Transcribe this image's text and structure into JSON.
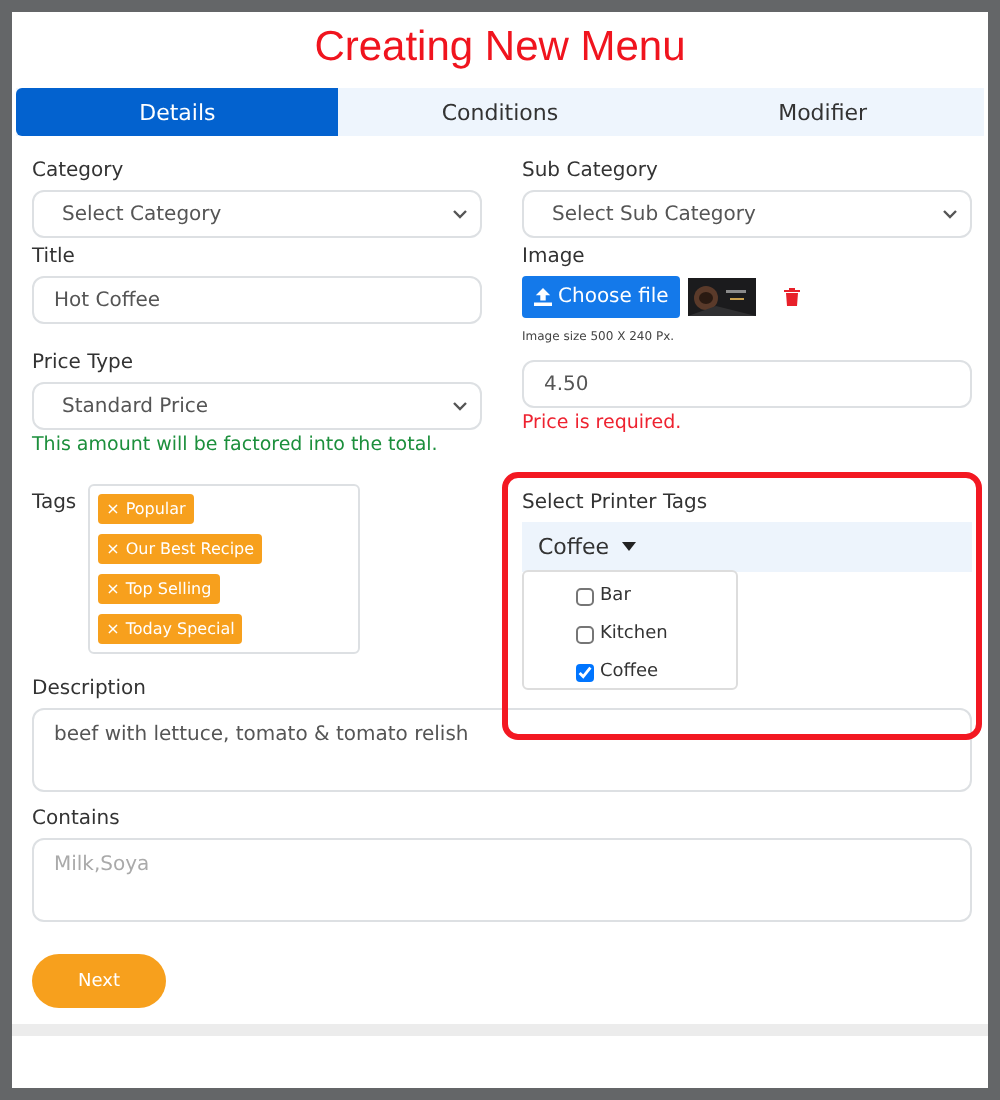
{
  "title": "Creating New Menu",
  "tabs": [
    {
      "label": "Details",
      "selected": true
    },
    {
      "label": "Conditions",
      "selected": false
    },
    {
      "label": "Modifier",
      "selected": false
    }
  ],
  "category": {
    "label": "Category",
    "value": "Select Category"
  },
  "sub_category": {
    "label": "Sub Category",
    "value": "Select Sub Category"
  },
  "title_field": {
    "label": "Title",
    "value": "Hot Coffee"
  },
  "image": {
    "label": "Image",
    "button": "Choose file",
    "hint": "Image size 500 X 240 Px."
  },
  "price_type": {
    "label": "Price Type",
    "value": "Standard Price",
    "note": "This amount will be factored into the total."
  },
  "price": {
    "value": "4.50",
    "error": "Price is required."
  },
  "tags": {
    "label": "Tags",
    "items": [
      "Popular",
      "Our Best Recipe",
      "Top Selling",
      "Today Special"
    ],
    "remove_glyph": "×"
  },
  "printer_tags": {
    "label": "Select Printer Tags",
    "button": "Coffee",
    "expanded": true,
    "options": [
      {
        "label": "Bar",
        "checked": false
      },
      {
        "label": "Kitchen",
        "checked": false
      },
      {
        "label": "Coffee",
        "checked": true
      }
    ]
  },
  "description": {
    "label": "Description",
    "value": "beef with lettuce, tomato & tomato relish"
  },
  "contains": {
    "label": "Contains",
    "placeholder": "Milk,Soya"
  },
  "next_button": "Next"
}
